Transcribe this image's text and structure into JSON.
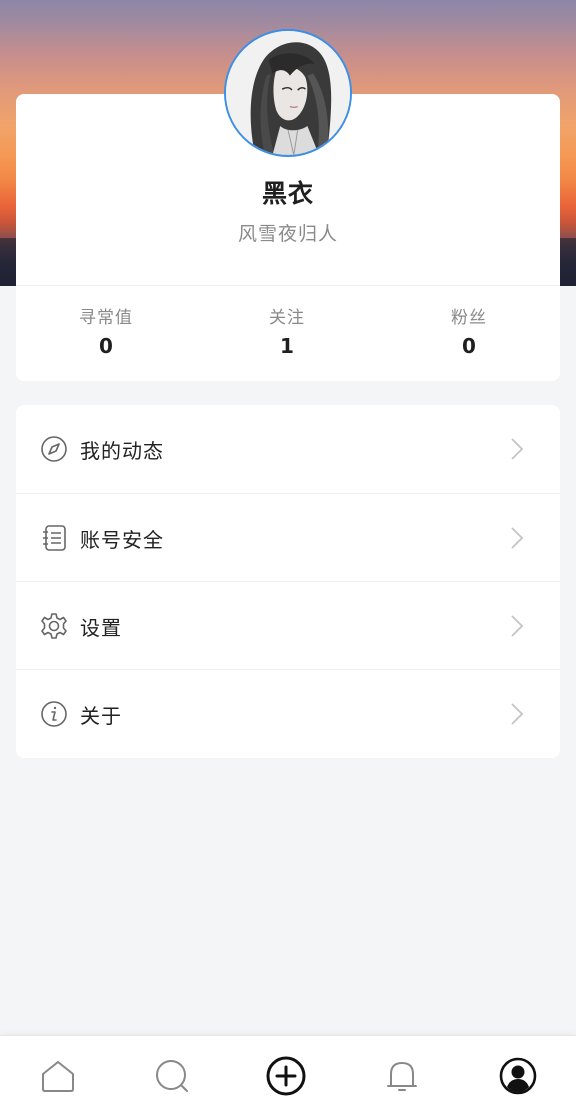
{
  "profile": {
    "name": "黑衣",
    "bio": "风雪夜归人",
    "avatar_icon": "avatar-portrait",
    "avatar_border_color": "#3a8fe8"
  },
  "stats": [
    {
      "label": "寻常值",
      "value": "0"
    },
    {
      "label": "关注",
      "value": "1"
    },
    {
      "label": "粉丝",
      "value": "0"
    }
  ],
  "menu": [
    {
      "label": "我的动态",
      "icon": "compass-icon"
    },
    {
      "label": "账号安全",
      "icon": "id-card-icon"
    },
    {
      "label": "设置",
      "icon": "gear-icon"
    },
    {
      "label": "关于",
      "icon": "info-icon"
    }
  ],
  "bottom_nav": [
    {
      "icon": "home-icon",
      "active": false
    },
    {
      "icon": "search-icon",
      "active": false
    },
    {
      "icon": "add-circle-icon",
      "active": false
    },
    {
      "icon": "bell-icon",
      "active": false
    },
    {
      "icon": "profile-icon",
      "active": true
    }
  ],
  "colors": {
    "page_background": "#f4f5f7",
    "card": "#ffffff",
    "muted_text": "#8a8a8a",
    "icon_gray": "#888888"
  }
}
